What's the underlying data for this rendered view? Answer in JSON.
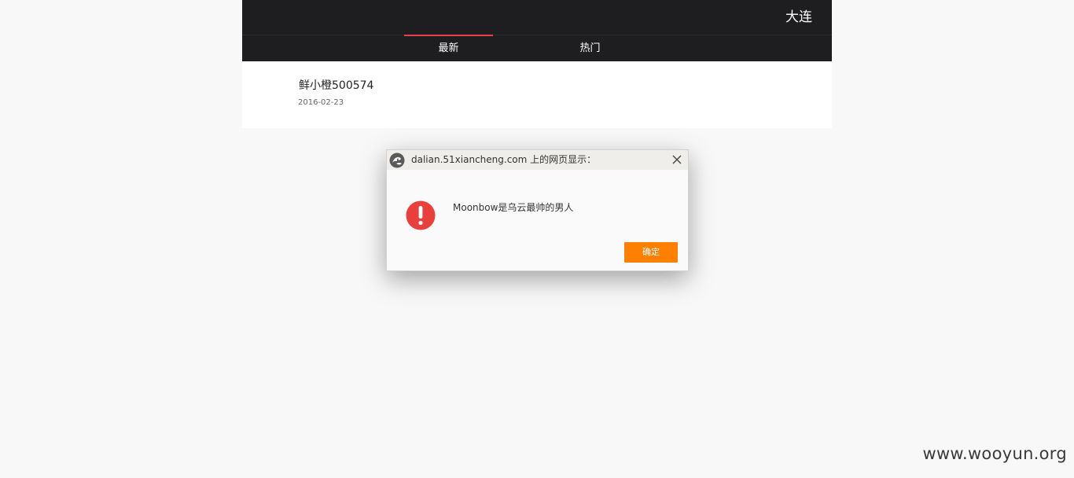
{
  "header": {
    "city": "大连"
  },
  "tabs": [
    {
      "label": "最新",
      "active": true
    },
    {
      "label": "热门",
      "active": false
    }
  ],
  "post": {
    "title": "鲜小橙500574",
    "date": "2016-02-23"
  },
  "dialog": {
    "title": "dalian.51xiancheng.com 上的网页显示：",
    "message": "Moonbow是乌云最帅的男人",
    "ok_label": "确定",
    "icon": "exclamation-icon",
    "accent_color": "#ff8000",
    "icon_color": "#e8403c"
  },
  "colors": {
    "topbar_bg": "#1e1e20",
    "tab_indicator": "#e8404b"
  },
  "watermark": "www.wooyun.org"
}
